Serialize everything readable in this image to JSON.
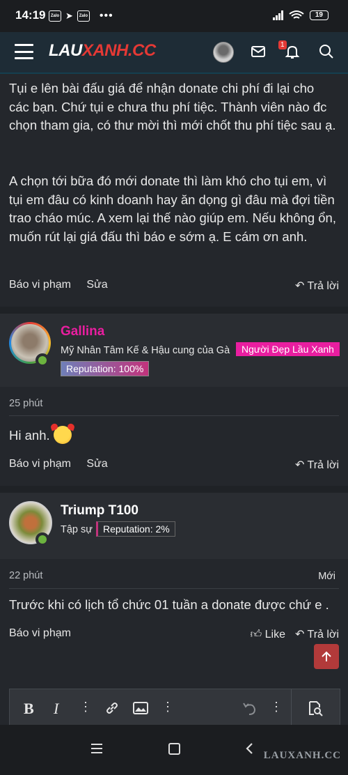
{
  "status_bar": {
    "time": "14:19",
    "zalo_label": "Zalo",
    "battery": "19"
  },
  "header": {
    "logo_part1": "LAU",
    "logo_part2": "XANH",
    "logo_part3": ".CC",
    "notification_count": "1"
  },
  "post1": {
    "paragraph1": "Tụi e lên bài đấu giá để nhận donate chi phí đi lại cho các bạn. Chứ tụi e chưa thu phí tiệc. Thành viên nào đc chọn tham gia, có thư mời thì mới chốt thu phí tiệc sau ạ.",
    "paragraph2": "A chọn tới bữa đó mới donate thì làm khó cho tụi em, vì tụi em đâu có kinh doanh hay ăn dọng gì đâu mà đợi tiền trao cháo múc. A xem lại thế nào giúp em. Nếu không ổn, muốn rút lại giá đấu thì báo e sớm ạ. E cám ơn anh.",
    "report_label": "Báo vi phạm",
    "edit_label": "Sửa",
    "reply_label": "Trả lời"
  },
  "post2": {
    "username": "Gallina",
    "user_title": "Mỹ Nhân Tâm Kế & Hậu cung của Gà",
    "banner": "Người Đẹp Lầu Xanh",
    "reputation": "Reputation: 100%",
    "time": "25 phút",
    "content": "Hi anh.",
    "report_label": "Báo vi phạm",
    "edit_label": "Sửa",
    "reply_label": "Trả lời"
  },
  "post3": {
    "username": "Triump T100",
    "user_title": "Tập sự",
    "reputation": "Reputation: 2%",
    "time": "22 phút",
    "new_label": "Mới",
    "content": "Trước khi có lịch tổ chức 01 tuần a donate được chứ e .",
    "report_label": "Báo vi phạm",
    "like_label": "Like",
    "reply_label": "Trả lời"
  },
  "watermark": "LAUXANH.CC",
  "colors": {
    "accent_red": "#e53935",
    "banner_pink": "#e91ea0",
    "online_green": "#6cb33f",
    "header_bg": "#1e2c36"
  }
}
